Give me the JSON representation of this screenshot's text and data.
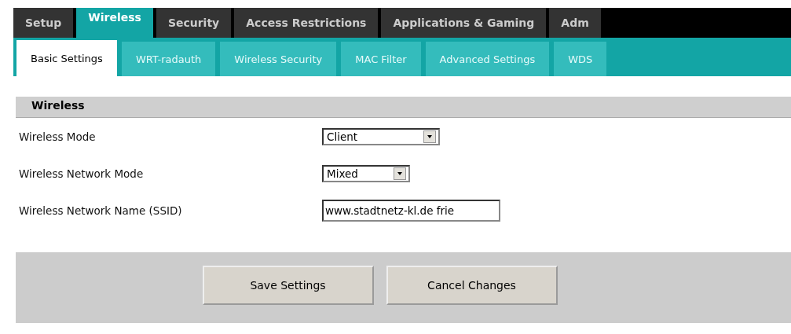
{
  "main_tabs": [
    {
      "label": "Setup",
      "selected": false
    },
    {
      "label": "Wireless",
      "selected": true
    },
    {
      "label": "Security",
      "selected": false
    },
    {
      "label": "Access Restrictions",
      "selected": false
    },
    {
      "label": "Applications & Gaming",
      "selected": false
    },
    {
      "label": "Adm",
      "selected": false
    }
  ],
  "sub_tabs": [
    {
      "label": "Basic Settings",
      "selected": true
    },
    {
      "label": "WRT-radauth",
      "selected": false
    },
    {
      "label": "Wireless Security",
      "selected": false
    },
    {
      "label": "MAC Filter",
      "selected": false
    },
    {
      "label": "Advanced Settings",
      "selected": false
    },
    {
      "label": "WDS",
      "selected": false
    }
  ],
  "section": {
    "title": "Wireless"
  },
  "fields": [
    {
      "kind": "select",
      "label": "Wireless Mode",
      "value": "Client"
    },
    {
      "kind": "select",
      "label": "Wireless Network Mode",
      "value": "Mixed"
    },
    {
      "kind": "text",
      "label": "Wireless Network Name (SSID)",
      "value": "www.stadtnetz-kl.de frie"
    }
  ],
  "buttons": [
    "Save Settings",
    "Cancel Changes"
  ]
}
